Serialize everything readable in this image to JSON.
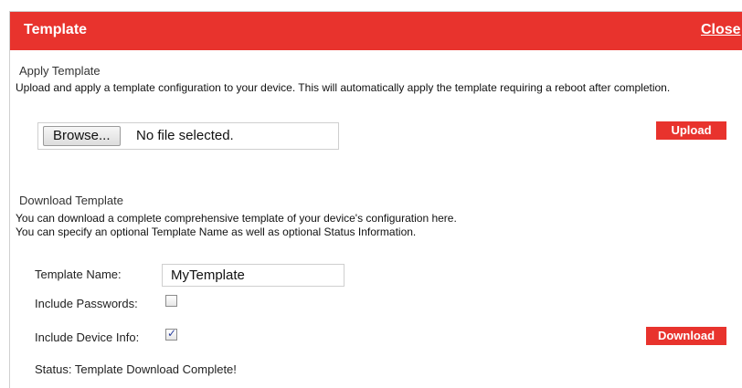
{
  "dialog": {
    "title": "Template",
    "close_label": "Close"
  },
  "apply": {
    "heading": "Apply Template",
    "description": "Upload and apply a template configuration to your device. This will automatically apply the template requiring a reboot after completion.",
    "browse_label": "Browse...",
    "file_status": "No file selected.",
    "upload_label": "Upload"
  },
  "download": {
    "heading": "Download Template",
    "description_line1": "You can download a complete comprehensive template of your device's configuration here.",
    "description_line2": "You can specify an optional Template Name as well as optional Status Information.",
    "template_name_label": "Template Name:",
    "template_name_value": "MyTemplate",
    "include_passwords_label": "Include Passwords:",
    "include_passwords_checked": false,
    "include_device_info_label": "Include Device Info:",
    "include_device_info_checked": true,
    "download_label": "Download",
    "status_label": "Status:",
    "status_value": "Template Download Complete!"
  },
  "colors": {
    "accent": "#e8332d",
    "checkmark": "#2b3f9e"
  }
}
